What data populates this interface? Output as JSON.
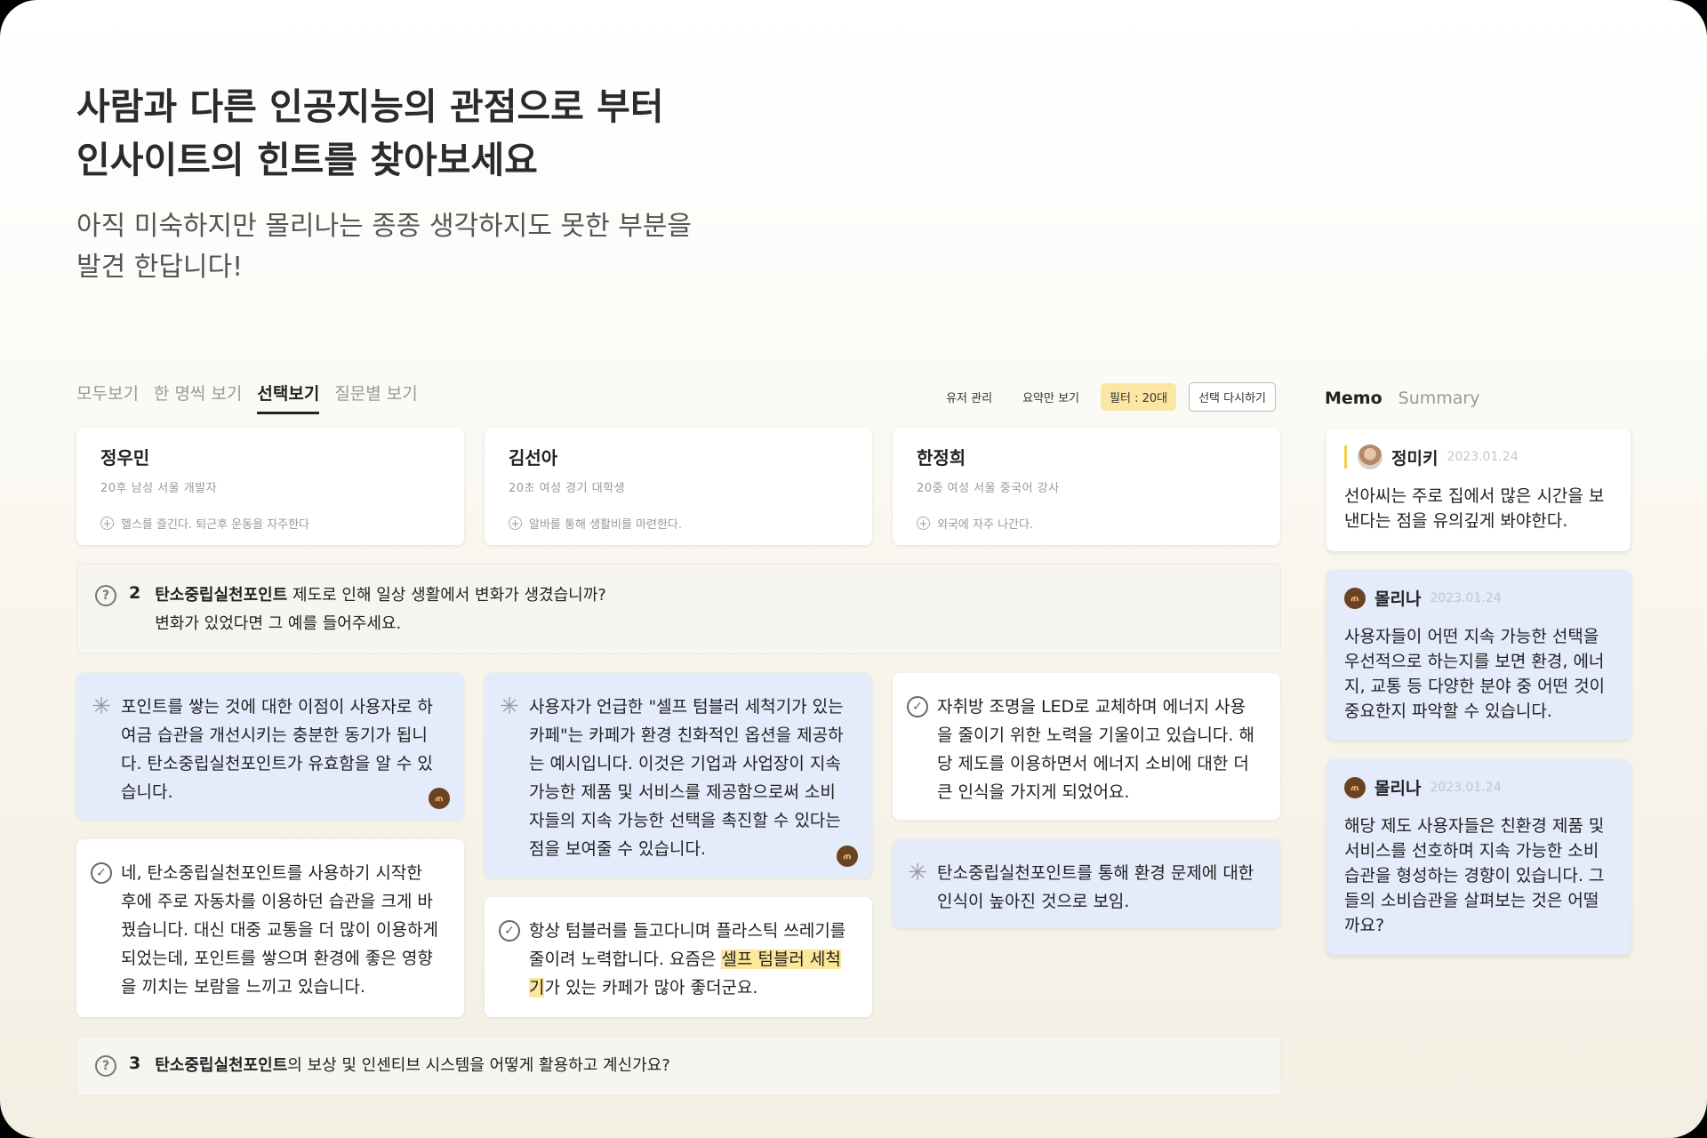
{
  "hero": {
    "title_line1": "사람과 다른 인공지능의 관점으로 부터",
    "title_line2": "인사이트의 힌트를 찾아보세요",
    "sub_line1": "아직 미숙하지만 몰리나는 종종 생각하지도 못한 부분을",
    "sub_line2": "발견 한답니다!"
  },
  "tabs": [
    "모두보기",
    "한 명씩 보기",
    "선택보기",
    "질문별 보기"
  ],
  "active_tab": "선택보기",
  "tools": {
    "user_manage": "유저 관리",
    "summary_only": "요약만 보기",
    "filter": "필터 : 20대",
    "reset": "선택 다시하기"
  },
  "people": [
    {
      "name": "정우민",
      "meta": "20후   남성   서울   개발자",
      "note": "헬스를 즐긴다. 퇴근후 운동을 자주한다"
    },
    {
      "name": "김선아",
      "meta": "20초   여성   경기   대학생",
      "note": "알바를 통해 생활비를 마련한다."
    },
    {
      "name": "한정희",
      "meta": "20중   여성   서울   중국어 강사",
      "note": "외국에 자주 나간다."
    }
  ],
  "questions": [
    {
      "number": "2",
      "keyword": "탄소중립실천포인트",
      "rest": " 제도로 인해 일상 생활에서 변화가 생겼습니까?",
      "line2": "변화가 있었다면 그 예를 들어주세요."
    },
    {
      "number": "3",
      "keyword": "탄소중립실천포인트",
      "rest": "의 보상 및 인센티브 시스템을 어떻게 활용하고 계신가요?"
    }
  ],
  "answers": {
    "c1_ai": "포인트를 쌓는 것에 대한 이점이 사용자로 하여금 습관을 개선시키는 충분한 동기가 됩니다. 탄소중립실천포인트가 유효함을 알 수 있습니다.",
    "c1_user": "네, 탄소중립실천포인트를 사용하기 시작한 후에 주로 자동차를 이용하던 습관을 크게 바꿨습니다. 대신 대중 교통을 더 많이 이용하게 되었는데, 포인트를 쌓으며 환경에 좋은 영향을 끼치는 보람을 느끼고 있습니다.",
    "c2_ai": "사용자가 언급한 \"셀프 텀블러 세척기가 있는 카페\"는 카페가 환경 친화적인 옵션을 제공하는 예시입니다. 이것은 기업과 사업장이 지속 가능한 제품 및 서비스를 제공함으로써 소비자들의 지속 가능한 선택을 촉진할 수 있다는 점을 보여줄 수 있습니다.",
    "c2_user_pre": "항상 텀블러를 들고다니며 플라스틱 쓰레기를 줄이려 노력합니다. 요즘은 ",
    "c2_user_hl": "셀프 텀블러 세척기",
    "c2_user_post": "가 있는 카페가 많아 좋더군요.",
    "c3_user": "자취방 조명을 LED로 교체하며 에너지 사용을 줄이기 위한 노력을 기울이고 있습니다. 해당 제도를 이용하면서 에너지 소비에 대한 더 큰 인식을 가지게 되었어요.",
    "c3_ai": "탄소중립실천포인트를 통해 환경 문제에 대한 인식이 높아진 것으로 보임."
  },
  "panel": {
    "tabs": [
      "Memo",
      "Summary"
    ],
    "memos": [
      {
        "author": "정미키",
        "date": "2023.01.24",
        "body": "선아씨는 주로 집에서 많은 시간을 보낸다는 점을 유의깊게 봐야한다."
      },
      {
        "author": "몰리나",
        "date": "2023.01.24",
        "body": "사용자들이 어떤 지속 가능한 선택을 우선적으로 하는지를 보면 환경, 에너지, 교통 등 다양한 분야 중 어떤 것이 중요한지 파악할 수 있습니다."
      },
      {
        "author": "몰리나",
        "date": "2023.01.24",
        "body": "해당 제도 사용자들은 친환경 제품 및 서비스를 선호하며 지속 가능한 소비 습관을 형성하는 경향이 있습니다. 그들의 소비습관을 살펴보는 것은 어떨까요?"
      }
    ]
  },
  "icons": {
    "ai_logo": "molly-logo-icon",
    "add": "plus-circle-icon",
    "question": "question-circle-icon",
    "check": "check-circle-icon",
    "spark": "loading-spark-icon"
  },
  "colors": {
    "ai_card": "#e4ebfb",
    "highlight": "#fde79a",
    "filter_chip": "#fbe6a4"
  }
}
